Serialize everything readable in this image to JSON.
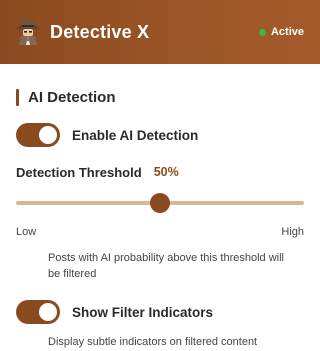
{
  "header": {
    "logo_icon": "detective-icon",
    "title": "Detective X",
    "status": "Active",
    "status_color": "#3cb44b",
    "background": "#8a4a1f"
  },
  "section": {
    "title": "AI Detection"
  },
  "ai_detection": {
    "label": "Enable AI Detection",
    "enabled": true
  },
  "threshold": {
    "label": "Detection Threshold",
    "value_text": "50%",
    "value": 0.5,
    "low_label": "Low",
    "high_label": "High",
    "hint": "Posts with AI probability above this threshold will be filtered"
  },
  "filter_indicators": {
    "label": "Show Filter Indicators",
    "enabled": true,
    "hint": "Display subtle indicators on filtered content"
  },
  "colors": {
    "accent": "#8a4a1f",
    "track": "#d6b994"
  }
}
